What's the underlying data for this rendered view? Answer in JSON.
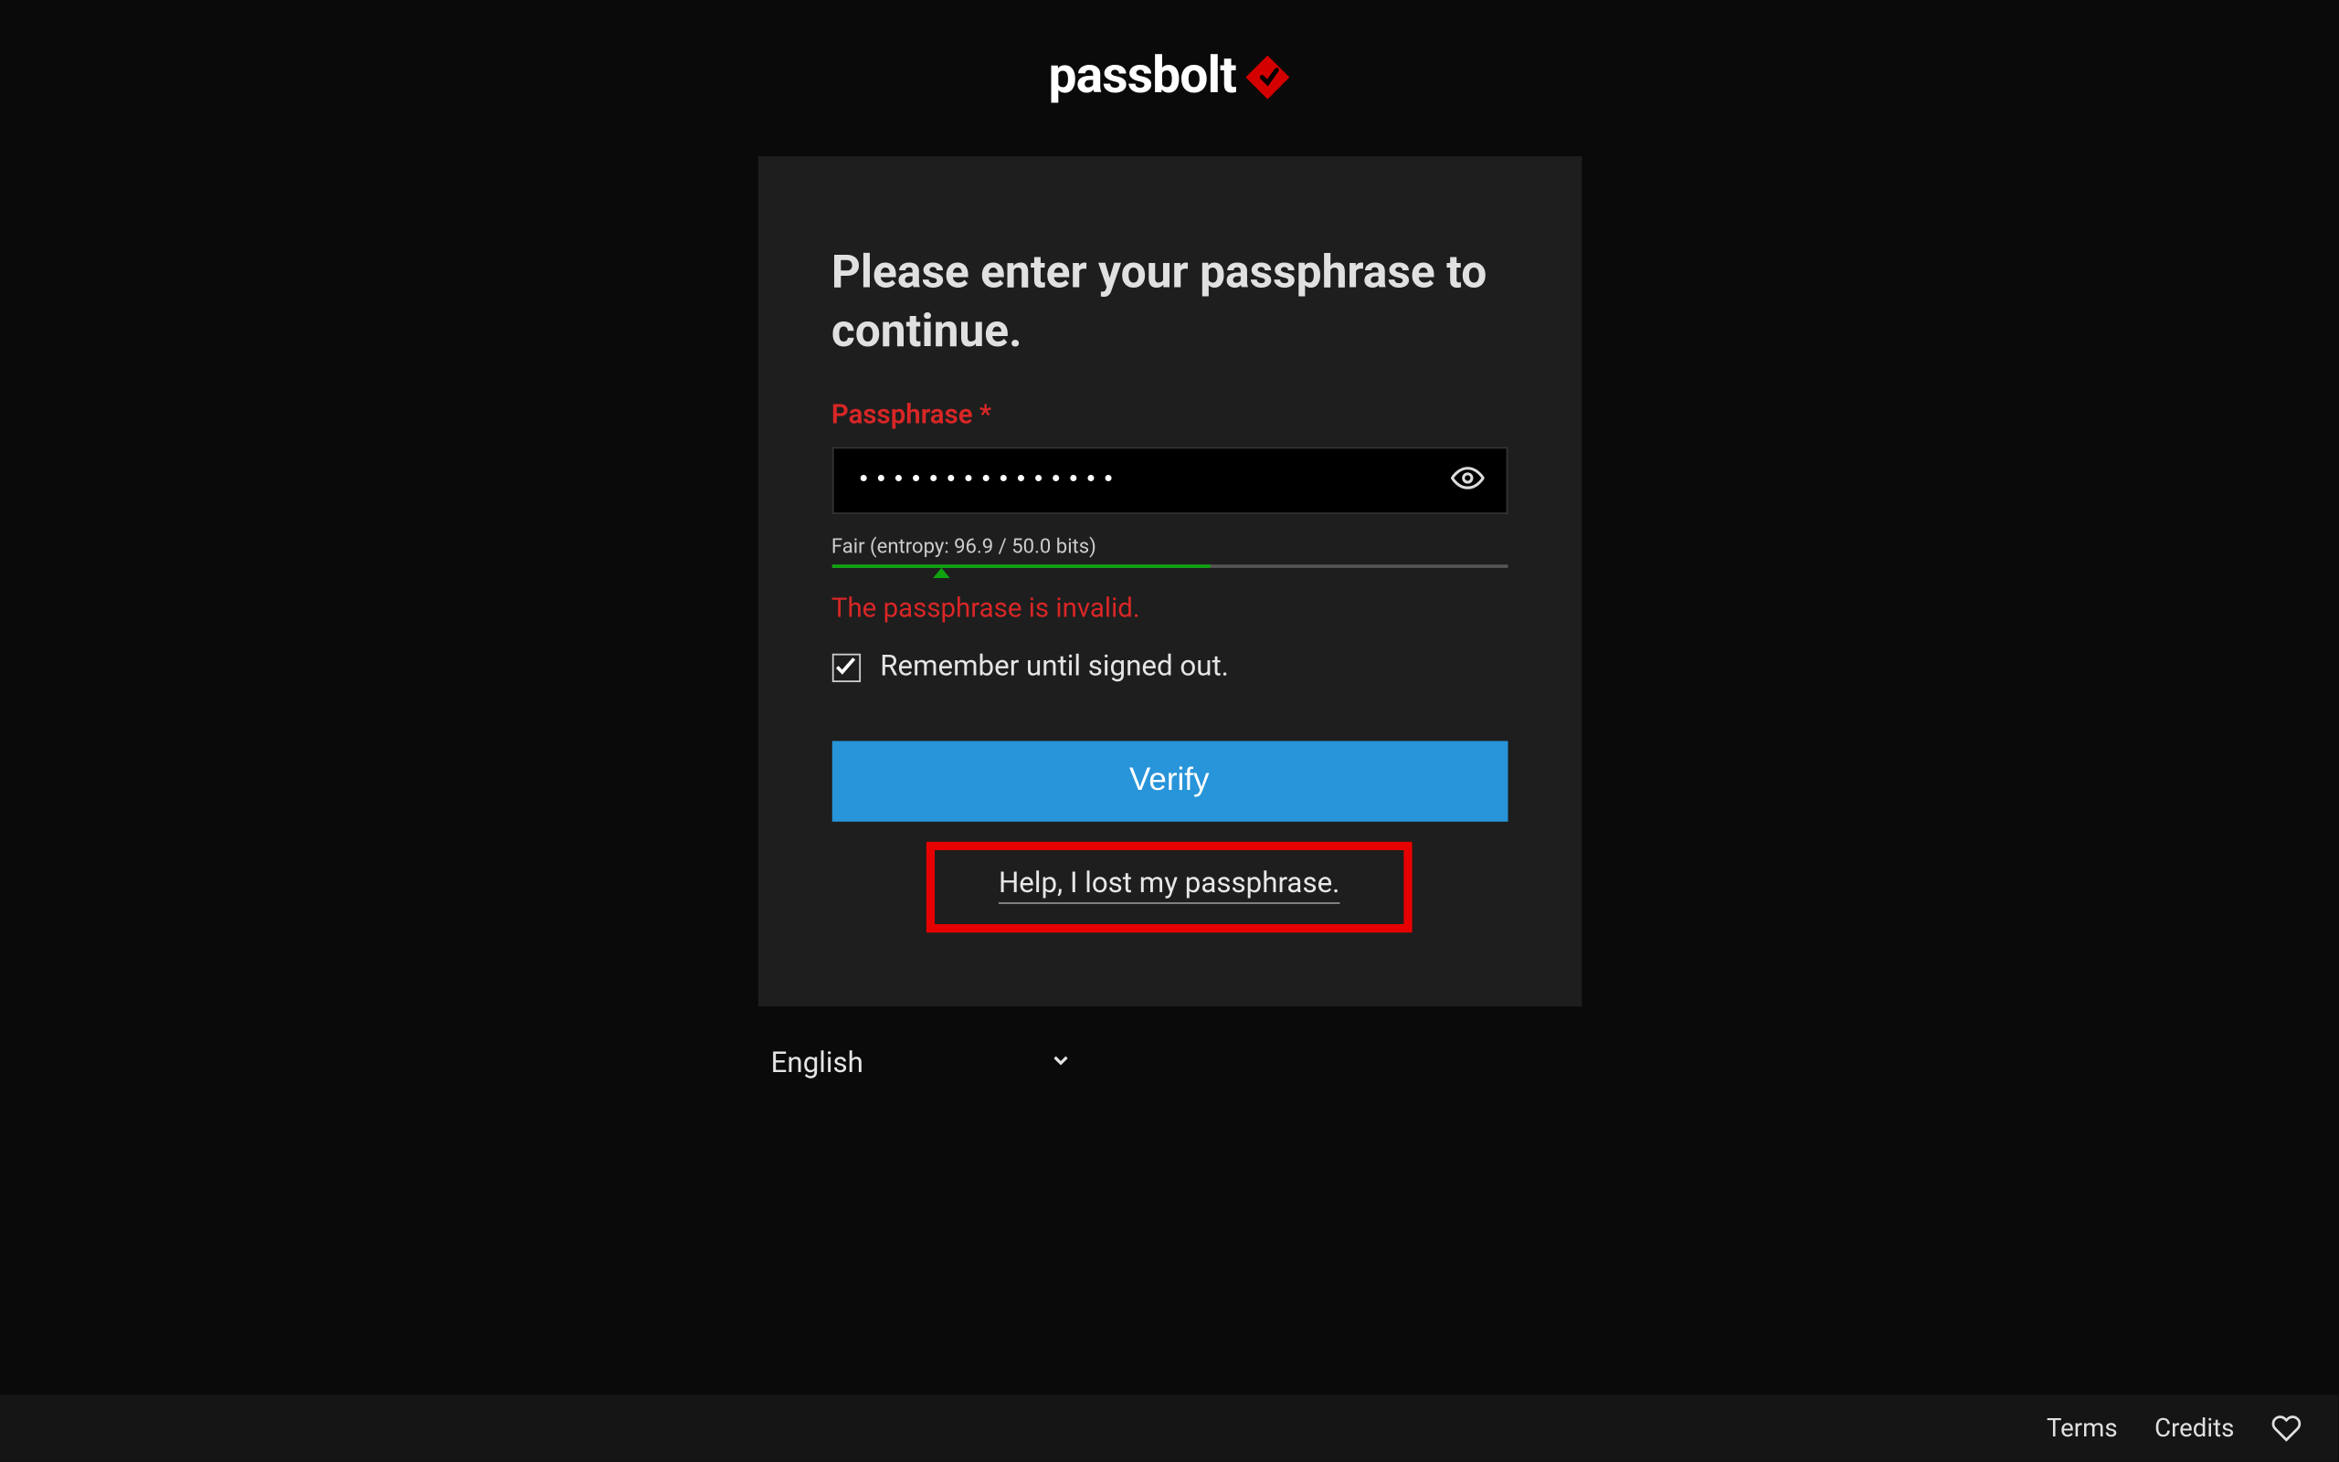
{
  "brand": {
    "name": "passbolt"
  },
  "card": {
    "title": "Please enter your passphrase to continue.",
    "passphrase_label": "Passphrase",
    "passphrase_value": "•••••••••••••••",
    "entropy_text": "Fair (entropy: 96.9 / 50.0 bits)",
    "error_message": "The passphrase is invalid.",
    "remember_label": "Remember until signed out.",
    "remember_checked": true,
    "verify_label": "Verify",
    "help_link": "Help, I lost my passphrase.",
    "strength_percent": 56,
    "marker_percent": 15
  },
  "language": {
    "selected": "English"
  },
  "footer": {
    "terms": "Terms",
    "credits": "Credits"
  },
  "colors": {
    "accent": "#2894d9",
    "error": "#d92626",
    "brand_red": "#e60000"
  }
}
